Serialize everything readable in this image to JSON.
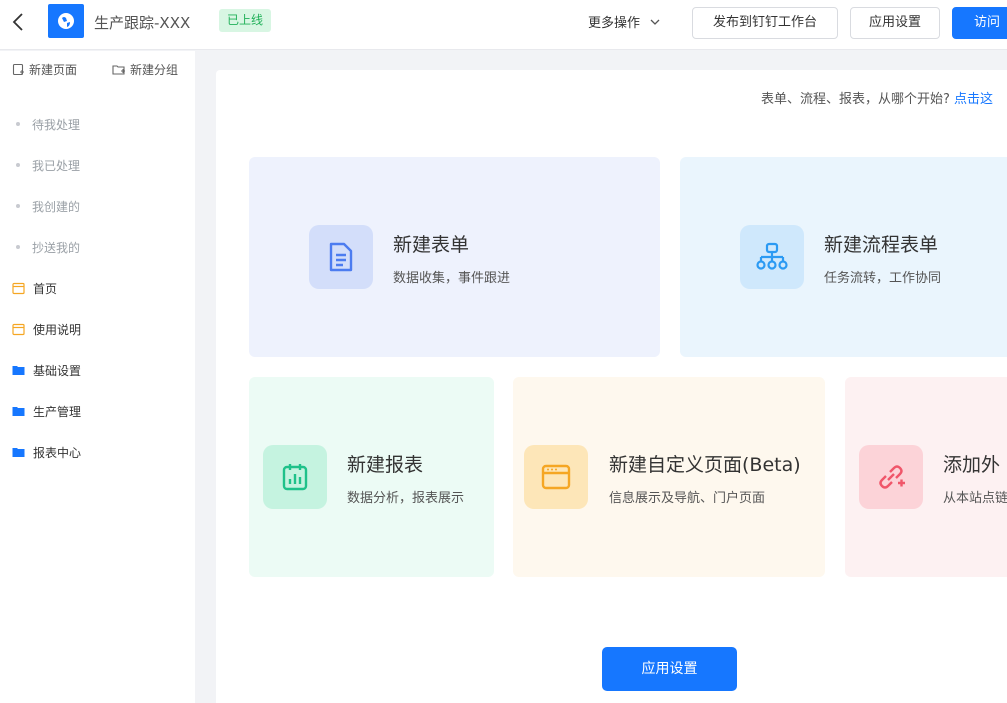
{
  "header": {
    "title": "生产跟踪-XXX",
    "status": "已上线",
    "more_actions": "更多操作",
    "publish_label": "发布到钉钉工作台",
    "settings_label": "应用设置",
    "visit_label": "访问",
    "accent": "#1677ff"
  },
  "sidebar": {
    "new_page": "新建页面",
    "new_group": "新建分组",
    "items": [
      {
        "label": "待我处理",
        "kind": "system"
      },
      {
        "label": "我已处理",
        "kind": "system"
      },
      {
        "label": "我创建的",
        "kind": "system"
      },
      {
        "label": "抄送我的",
        "kind": "system"
      },
      {
        "label": "首页",
        "kind": "page",
        "icon": "page-icon"
      },
      {
        "label": "使用说明",
        "kind": "page",
        "icon": "page-icon"
      },
      {
        "label": "基础设置",
        "kind": "folder",
        "icon": "folder-icon"
      },
      {
        "label": "生产管理",
        "kind": "folder",
        "icon": "folder-icon"
      },
      {
        "label": "报表中心",
        "kind": "folder",
        "icon": "folder-icon"
      }
    ]
  },
  "main": {
    "hint_text": "表单、流程、报表，从哪个开始?",
    "hint_link": "点击这",
    "tiles": [
      {
        "title": "新建表单",
        "desc": "数据收集，事件跟进",
        "icon": "form-icon",
        "color": "#4c7cf0"
      },
      {
        "title": "新建流程表单",
        "desc": "任务流转，工作协同",
        "icon": "flow-icon",
        "color": "#2b9af3"
      },
      {
        "title": "新建报表",
        "desc": "数据分析，报表展示",
        "icon": "report-icon",
        "color": "#1fc18a"
      },
      {
        "title": "新建自定义页面(Beta)",
        "desc": "信息展示及导航、门户页面",
        "icon": "custom-page-icon",
        "color": "#f5a623"
      },
      {
        "title": "添加外",
        "desc": "从本站点链",
        "icon": "external-link-icon",
        "color": "#f0566a"
      }
    ],
    "settings_button": "应用设置"
  }
}
